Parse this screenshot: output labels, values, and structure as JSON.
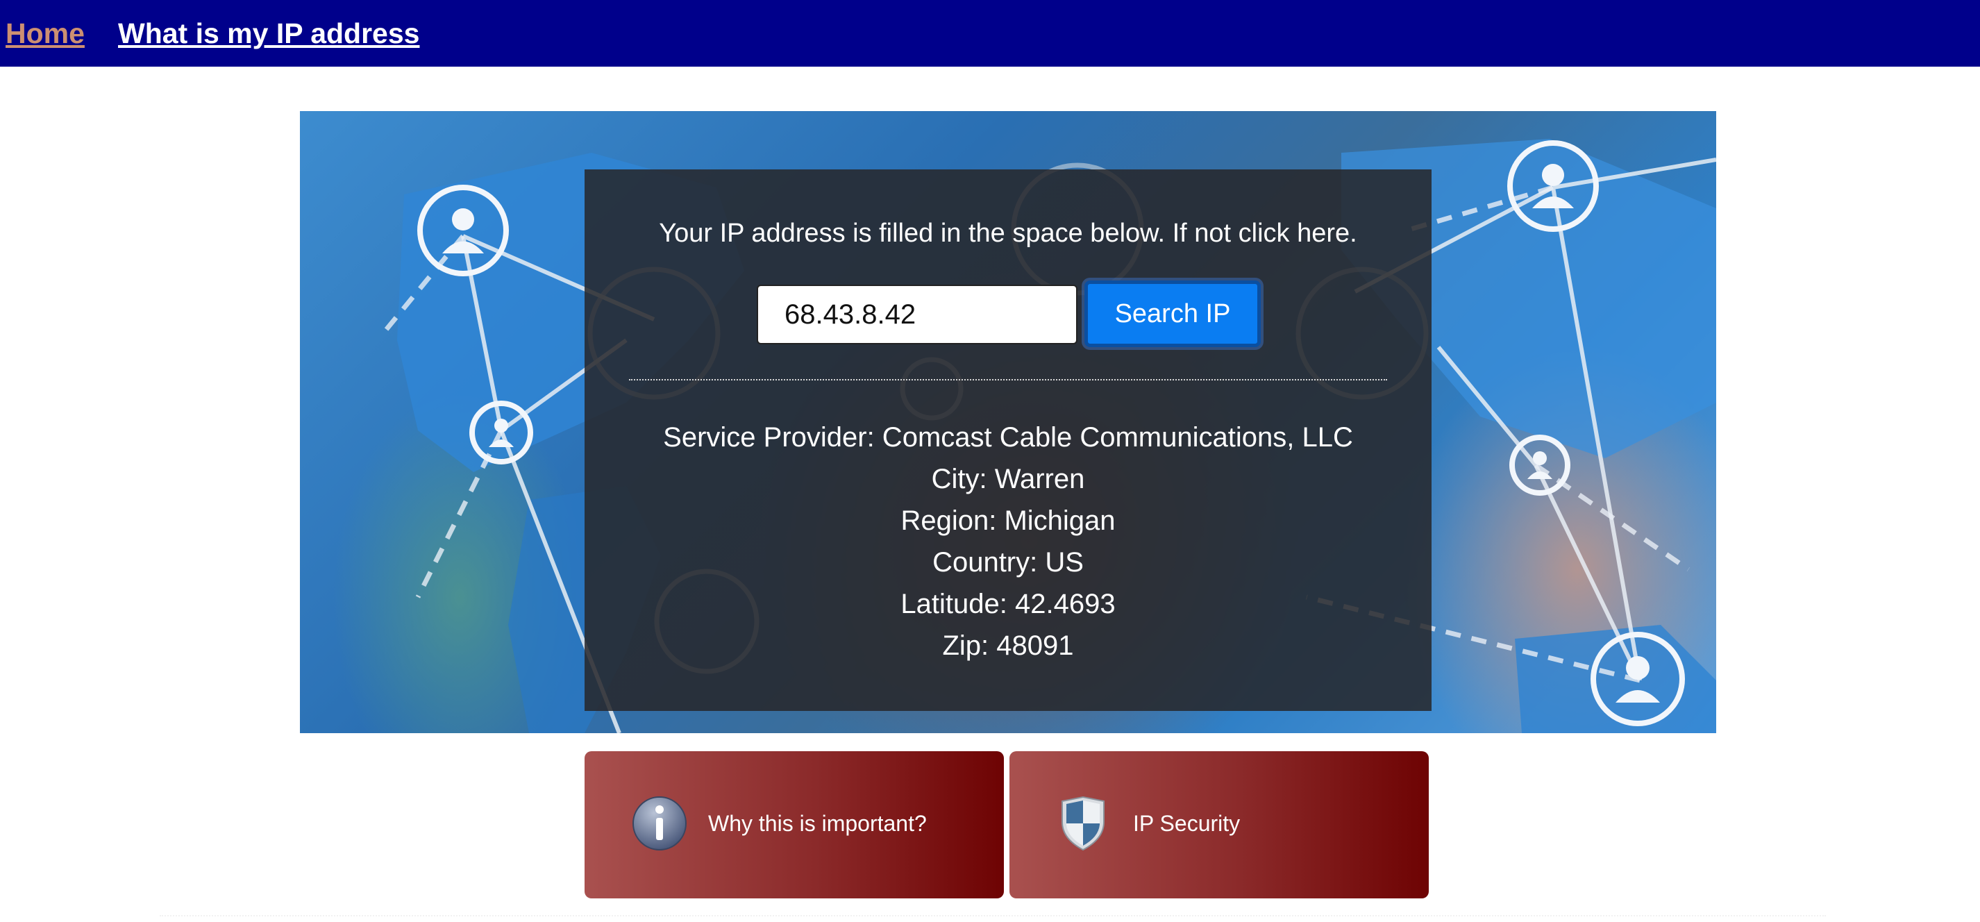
{
  "nav": {
    "home": "Home",
    "what_is_my_ip": "What is my IP address"
  },
  "search": {
    "instruction": "Your IP address is filled in the space below. If not click here.",
    "ip_value": "68.43.8.42",
    "button_label": "Search IP"
  },
  "result": {
    "service_provider": "Service Provider: Comcast Cable Communications, LLC",
    "city": "City: Warren",
    "region": "Region: Michigan",
    "country": "Country: US",
    "latitude": "Latitude: 42.4693",
    "zip": "Zip: 48091"
  },
  "cards": [
    {
      "label": "Why this is important?",
      "icon": "info-icon"
    },
    {
      "label": "IP Security",
      "icon": "shield-icon"
    }
  ],
  "colors": {
    "nav_bg": "#00008b",
    "home_link": "#cc8f72",
    "button": "#0a7df2",
    "card_dark": "#6e0303"
  }
}
